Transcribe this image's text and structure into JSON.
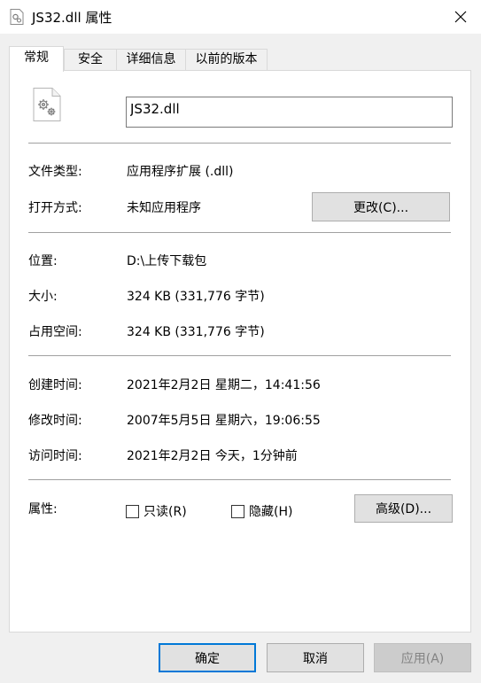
{
  "window": {
    "title": "JS32.dll 属性"
  },
  "tabs": [
    {
      "label": "常规",
      "active": true
    },
    {
      "label": "安全",
      "active": false
    },
    {
      "label": "详细信息",
      "active": false
    },
    {
      "label": "以前的版本",
      "active": false
    }
  ],
  "general": {
    "file_name": "JS32.dll",
    "file_type_label": "文件类型:",
    "file_type_value": "应用程序扩展 (.dll)",
    "opens_with_label": "打开方式:",
    "opens_with_value": "未知应用程序",
    "change_button": "更改(C)...",
    "location_label": "位置:",
    "location_value": "D:\\上传下载包",
    "size_label": "大小:",
    "size_value": "324 KB (331,776 字节)",
    "size_on_disk_label": "占用空间:",
    "size_on_disk_value": "324 KB (331,776 字节)",
    "created_label": "创建时间:",
    "created_value": "2021年2月2日 星期二，14:41:56",
    "modified_label": "修改时间:",
    "modified_value": "2007年5月5日 星期六，19:06:55",
    "accessed_label": "访问时间:",
    "accessed_value": "2021年2月2日 今天，1分钟前",
    "attributes_label": "属性:",
    "readonly_label": "只读(R)",
    "hidden_label": "隐藏(H)",
    "advanced_button": "高级(D)..."
  },
  "footer": {
    "ok": "确定",
    "cancel": "取消",
    "apply": "应用(A)"
  },
  "colors": {
    "accent": "#0078d7",
    "panel_bg": "#ffffff",
    "window_bg": "#f0f0f0"
  }
}
